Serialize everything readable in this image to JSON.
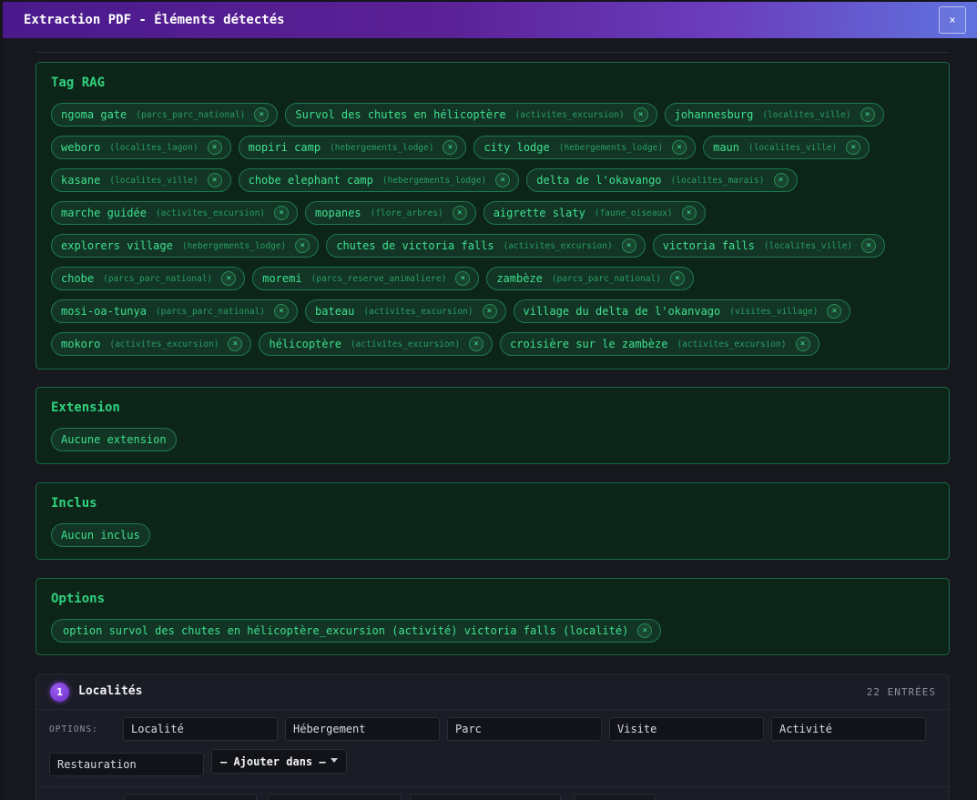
{
  "header": {
    "title": "Extraction PDF - Éléments détectés",
    "close_label": "×"
  },
  "sections": {
    "tag_rag": {
      "title": "Tag RAG",
      "tags": [
        {
          "label": "ngoma gate",
          "category": "(parcs_parc_national)"
        },
        {
          "label": "Survol des chutes en hélicoptère",
          "category": "(activites_excursion)"
        },
        {
          "label": "johannesburg",
          "category": "(localites_ville)"
        },
        {
          "label": "weboro",
          "category": "(localites_lagon)"
        },
        {
          "label": "mopiri camp",
          "category": "(hebergements_lodge)"
        },
        {
          "label": "city lodge",
          "category": "(hebergements_lodge)"
        },
        {
          "label": "maun",
          "category": "(localites_ville)"
        },
        {
          "label": "kasane",
          "category": "(localites_ville)"
        },
        {
          "label": "chobe elephant camp",
          "category": "(hebergements_lodge)"
        },
        {
          "label": "delta de l'okavango",
          "category": "(localites_marais)"
        },
        {
          "label": "marche guidée",
          "category": "(activites_excursion)"
        },
        {
          "label": "mopanes",
          "category": "(flore_arbres)"
        },
        {
          "label": "aigrette slaty",
          "category": "(faune_oiseaux)"
        },
        {
          "label": "explorers village",
          "category": "(hebergements_lodge)"
        },
        {
          "label": "chutes de victoria falls",
          "category": "(activites_excursion)"
        },
        {
          "label": "victoria falls",
          "category": "(localites_ville)"
        },
        {
          "label": "chobe",
          "category": "(parcs_parc_national)"
        },
        {
          "label": "moremi",
          "category": "(parcs_reserve_animaliere)"
        },
        {
          "label": "zambèze",
          "category": "(parcs_parc_national)"
        },
        {
          "label": "mosi-oa-tunya",
          "category": "(parcs_parc_national)"
        },
        {
          "label": "bateau",
          "category": "(activites_excursion)"
        },
        {
          "label": "village du delta de l'okanvago",
          "category": "(visites_village)"
        },
        {
          "label": "mokoro",
          "category": "(activites_excursion)"
        },
        {
          "label": "hélicoptère",
          "category": "(activites_excursion)"
        },
        {
          "label": "croisière sur le zambèze",
          "category": "(activites_excursion)"
        }
      ]
    },
    "extension": {
      "title": "Extension",
      "empty": "Aucune extension"
    },
    "inclus": {
      "title": "Inclus",
      "empty": "Aucun inclus"
    },
    "options": {
      "title": "Options",
      "items": [
        {
          "label": "option survol des chutes en hélicoptère_excursion (activité) victoria falls (localité)"
        }
      ]
    }
  },
  "remove_icon": "×",
  "localites": {
    "step": "1",
    "title": "Localités",
    "entries": "22 ENTRÉES",
    "options_label": "OPTIONS:",
    "inputs": [
      "Localité",
      "Hébergement",
      "Parc",
      "Visite",
      "Activité",
      "Restauration"
    ],
    "add_select": "— Ajouter dans —"
  },
  "colors": {
    "header_gradient_start": "#4a1a8c",
    "header_gradient_end": "#5f73de",
    "section_bg": "#0d2419",
    "section_border": "#1a6a44",
    "accent_green": "#2fd27c",
    "step_badge": "#7a3ae0"
  }
}
